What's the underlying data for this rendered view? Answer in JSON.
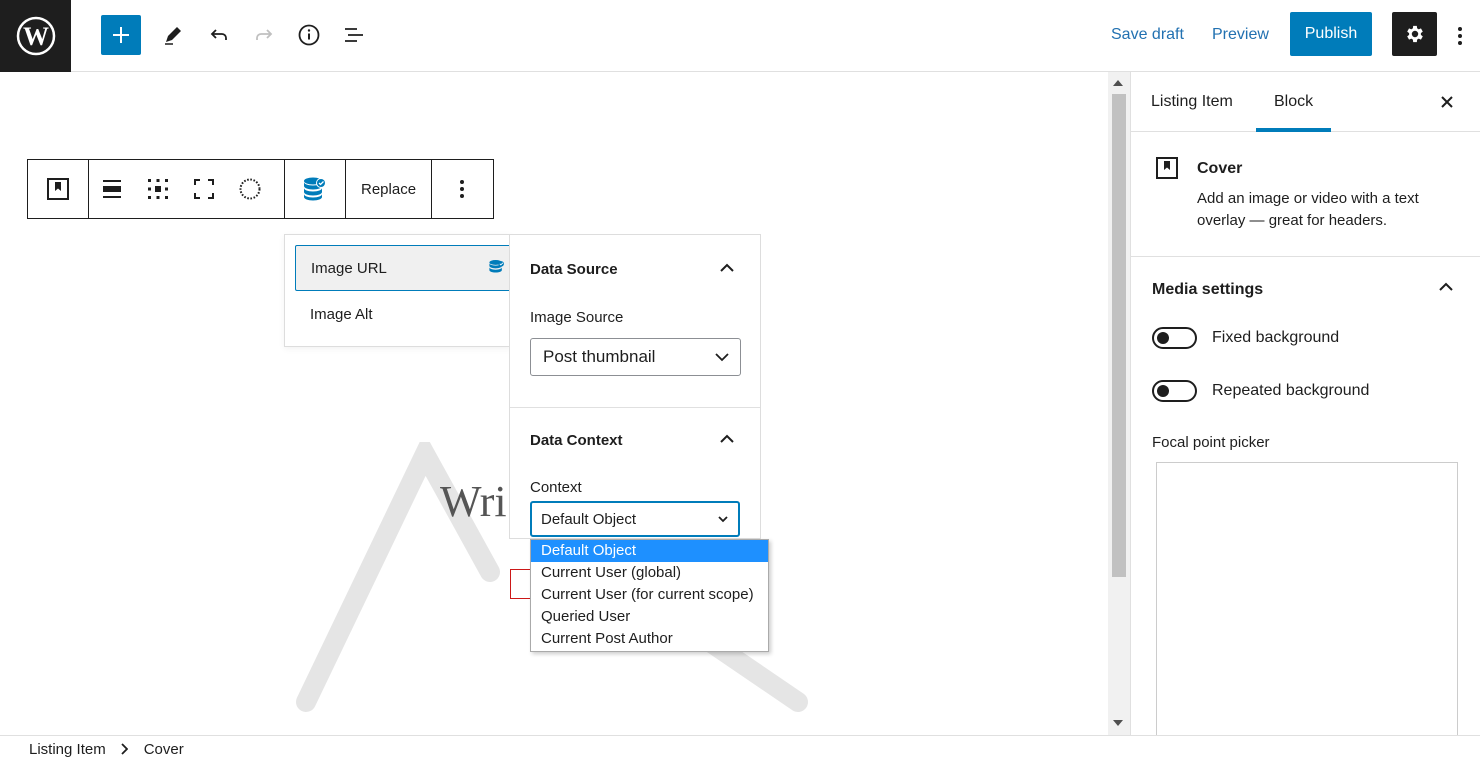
{
  "topbar": {
    "save_draft": "Save draft",
    "preview": "Preview",
    "publish": "Publish"
  },
  "toolbar": {
    "replace_label": "Replace"
  },
  "canvas": {
    "placeholder_text": "Wri"
  },
  "binding_list": {
    "items": [
      "Image URL",
      "Image Alt"
    ],
    "selected": "Image URL"
  },
  "binding_panel": {
    "data_source_title": "Data Source",
    "image_source_label": "Image Source",
    "image_source_value": "Post thumbnail",
    "data_context_title": "Data Context",
    "context_label": "Context",
    "context_value": "Default Object"
  },
  "context_dropdown": {
    "options": [
      "Default Object",
      "Current User (global)",
      "Current User (for current scope)",
      "Queried User",
      "Current Post Author"
    ],
    "highlighted": "Default Object"
  },
  "sidebar": {
    "tabs": [
      "Listing Item",
      "Block"
    ],
    "active_tab": "Block",
    "block_title": "Cover",
    "block_description": "Add an image or video with a text overlay — great for headers.",
    "media_settings_title": "Media settings",
    "fixed_background": "Fixed background",
    "repeated_background": "Repeated background",
    "focal_point_label": "Focal point picker"
  },
  "breadcrumb": [
    "Listing Item",
    "Cover"
  ],
  "colors": {
    "accent": "#007cba",
    "dark": "#1e1e1e",
    "dropdown_highlight": "#1e90ff",
    "link": "#2271b1"
  }
}
